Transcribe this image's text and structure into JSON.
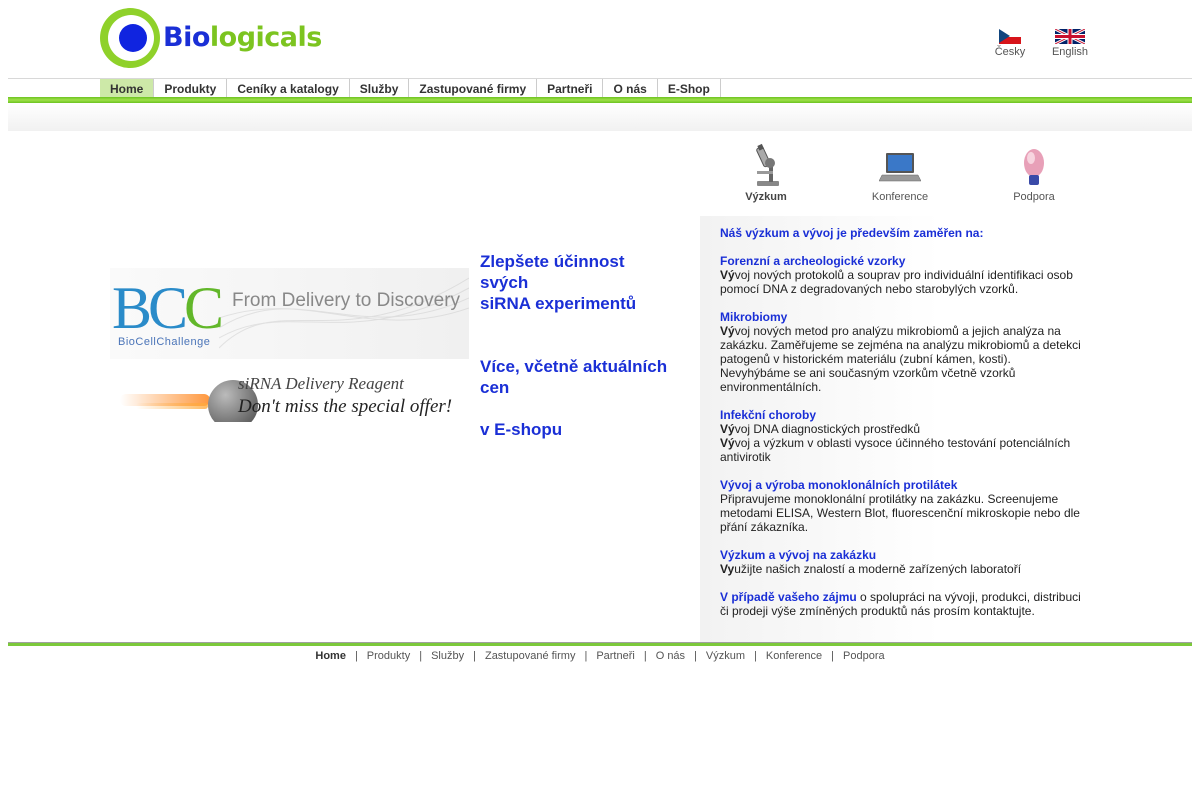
{
  "brand": {
    "logo_text_bio": "Bio",
    "logo_text_rest": "logicals"
  },
  "languages": [
    {
      "label": "Česky"
    },
    {
      "label": "English"
    }
  ],
  "nav": {
    "items": [
      "Home",
      "Produkty",
      "Ceníky a katalogy",
      "Služby",
      "Zastupované firmy",
      "Partneři",
      "O nás",
      "E-Shop"
    ],
    "active": "Home"
  },
  "icons": {
    "research": "Výzkum",
    "conference": "Konference",
    "support": "Podpora"
  },
  "banners": {
    "bcc_logo_b": "BC",
    "bcc_logo_c": "C",
    "bcc_slogan": "From Delivery to Discovery",
    "bcc_sub": "BioCellChallenge",
    "sirna_line1": "siRNA Delivery Reagent",
    "sirna_line2": "Don't miss the special offer!"
  },
  "promo": {
    "line1": "Zlepšete účinnost svých",
    "line2": "siRNA experimentů",
    "line3": "Více, včetně aktuálních cen",
    "line4": "v E-shopu"
  },
  "content": {
    "intro": "Náš výzkum a vývoj je především zaměřen na:",
    "sections": [
      {
        "title": "Forenzní a archeologické vzorky",
        "lead": "Vý",
        "text": "voj nových protokolů a souprav pro individuální identifikaci osob pomocí DNA z degradovaných nebo starobylých vzorků."
      },
      {
        "title": "Mikrobiomy",
        "lead": "Vý",
        "text": "voj nových metod pro analýzu mikrobiomů a jejich analýza na zakázku. Zaměřujeme se zejména na analýzu mikrobiomů a detekci patogenů v historickém materiálu (zubní kámen, kosti). Nevyhýbáme se ani současným vzorkům včetně vzorků environmentálních."
      },
      {
        "title": "Infekční choroby",
        "lead": "Vý",
        "text": "voj DNA diagnostických prostředků",
        "lead2": "Vý",
        "text2": "voj a výzkum v oblasti vysoce účinného testování potenciálních antivirotik"
      },
      {
        "title": "Vývoj a výroba monoklonálních protilátek",
        "lead": "",
        "text": "Připravujeme monoklonální protilátky na zakázku. Screenujeme metodami ELISA, Western Blot, fluorescenční mikroskopie nebo dle přání zákazníka."
      },
      {
        "title": "Výzkum a vývoj na zakázku",
        "lead": "Vy",
        "text": "užijte našich znalostí a moderně zařízených laboratoří"
      }
    ],
    "contact_link": "V případě vašeho zájmu",
    "contact_text": " o spolupráci na vývoji, produkci, distribuci či prodeji výše zmíněných produktů nás prosím kontaktujte."
  },
  "footer": {
    "items": [
      "Home",
      "Produkty",
      "Služby",
      "Zastupované firmy",
      "Partneři",
      "O nás",
      "Výzkum",
      "Konference",
      "Podpora"
    ],
    "separator": "|"
  },
  "colors": {
    "brand_blue": "#1a2fd6",
    "brand_green": "#7cc420",
    "nav_active": "#cde9a8"
  }
}
